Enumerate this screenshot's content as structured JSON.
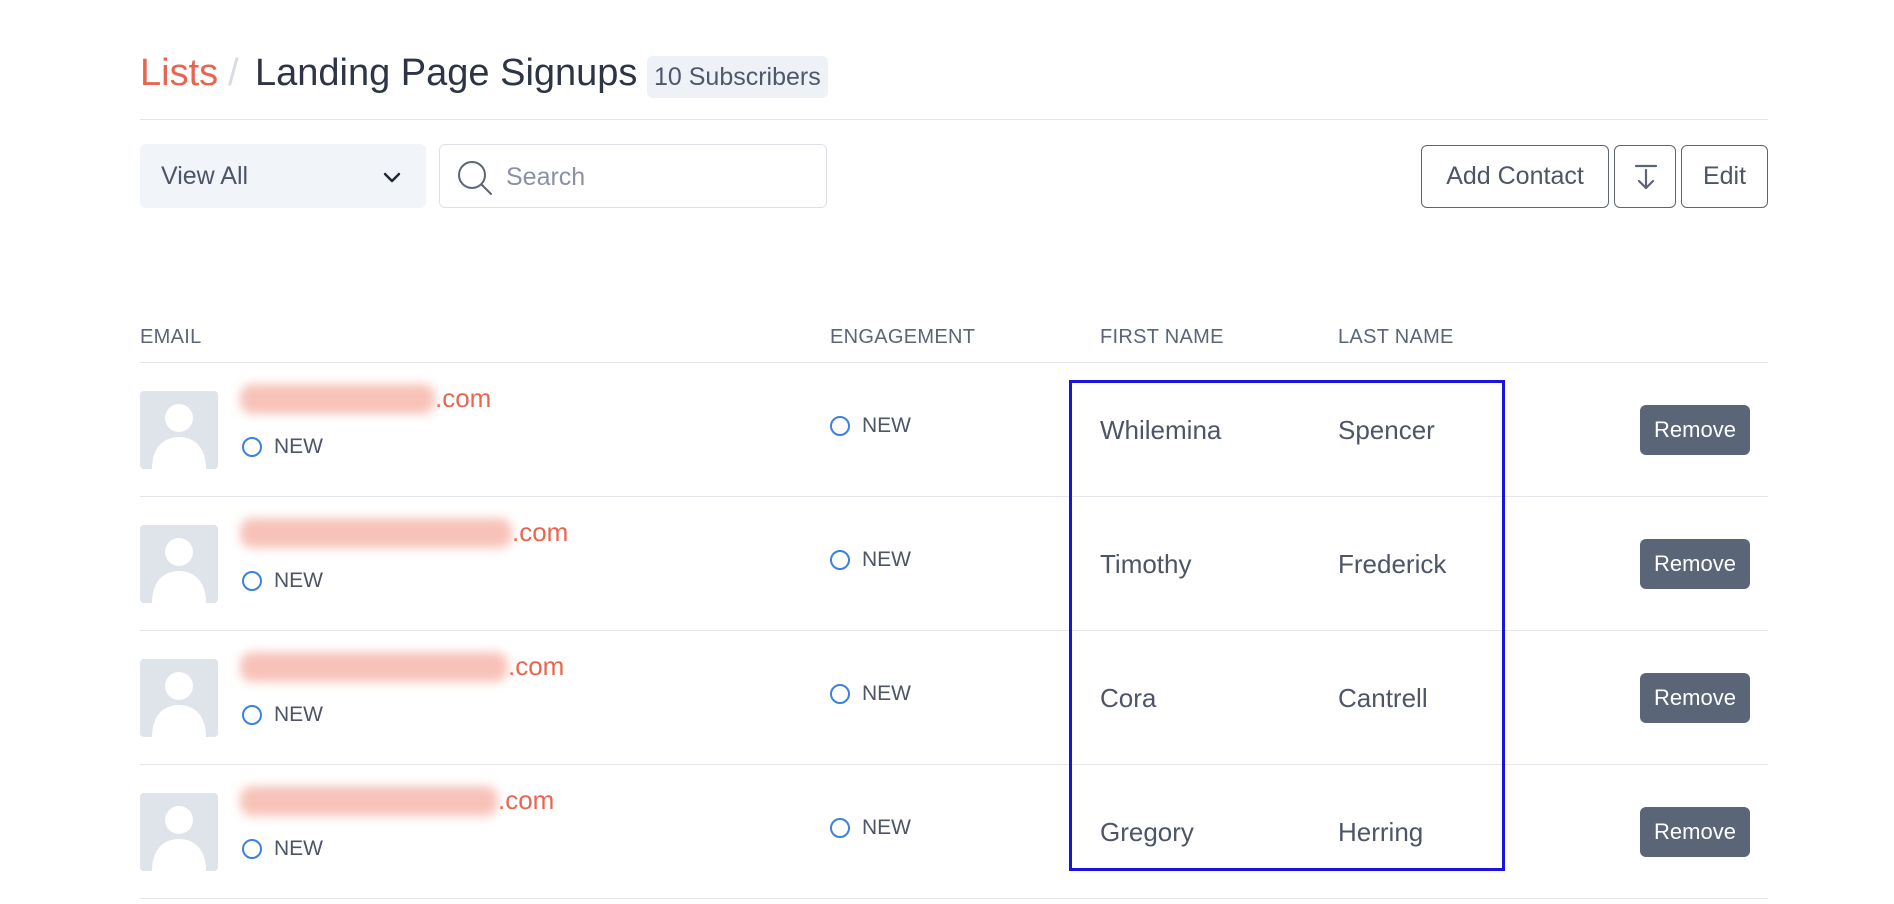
{
  "header": {
    "breadcrumb_lists": "Lists",
    "separator": "/",
    "title": "Landing Page Signups",
    "subscriber_count": "10 Subscribers"
  },
  "toolbar": {
    "filter_value": "View All",
    "search_placeholder": "Search",
    "add_contact_label": "Add Contact",
    "download_icon": "download-icon",
    "edit_label": "Edit"
  },
  "table": {
    "columns": [
      "EMAIL",
      "ENGAGEMENT",
      "FIRST NAME",
      "LAST NAME"
    ],
    "rows": [
      {
        "email_domain": ".com",
        "status": "NEW",
        "engagement": "NEW",
        "first_name": "Whilemina",
        "last_name": "Spencer",
        "action": "Remove"
      },
      {
        "email_domain": ".com",
        "status": "NEW",
        "engagement": "NEW",
        "first_name": "Timothy",
        "last_name": "Frederick",
        "action": "Remove"
      },
      {
        "email_domain": ".com",
        "status": "NEW",
        "engagement": "NEW",
        "first_name": "Cora",
        "last_name": "Cantrell",
        "action": "Remove"
      },
      {
        "email_domain": ".com",
        "status": "NEW",
        "engagement": "NEW",
        "first_name": "Gregory",
        "last_name": "Herring",
        "action": "Remove"
      }
    ]
  },
  "colors": {
    "accent": "#e8664f",
    "status_ring": "#3b82e0",
    "remove_button": "#5a6678",
    "highlight": "#1a12e0"
  }
}
